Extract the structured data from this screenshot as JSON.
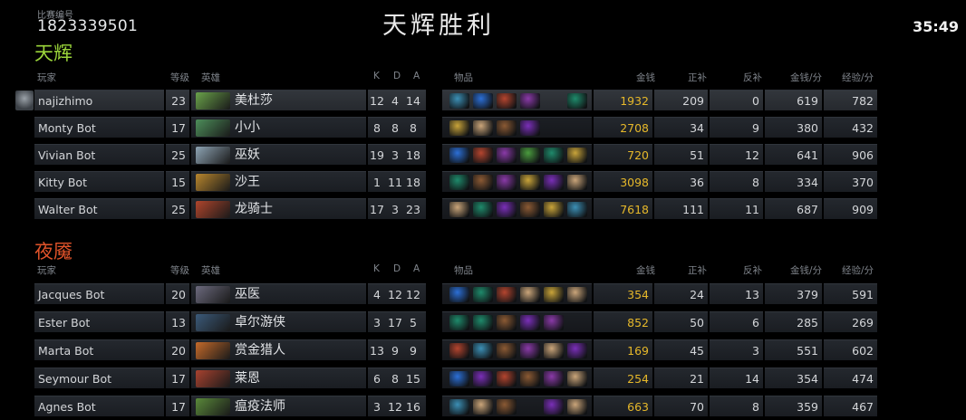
{
  "match": {
    "id_label": "比赛编号",
    "id": "1823339501",
    "result": "天辉胜利",
    "time": "35:49"
  },
  "headers": {
    "player": "玩家",
    "level": "等级",
    "hero": "英雄",
    "k": "K",
    "d": "D",
    "a": "A",
    "items": "物品",
    "gold": "金钱",
    "last_hits": "正补",
    "denies": "反补",
    "gpm": "金钱/分",
    "xpm": "经验/分"
  },
  "radiant": {
    "name": "天辉",
    "color": "#9ad43a",
    "players": [
      {
        "name": "najizhimo",
        "level": "23",
        "hero": "美杜莎",
        "k": "12",
        "d": "4",
        "a": "14",
        "gold": "1932",
        "lh": "209",
        "dn": "0",
        "gpm": "619",
        "xpm": "782",
        "items": [
          0,
          1,
          2,
          3,
          "",
          5
        ]
      },
      {
        "name": "Monty Bot",
        "level": "17",
        "hero": "小小",
        "k": "8",
        "d": "8",
        "a": "8",
        "gold": "2708",
        "lh": "34",
        "dn": "9",
        "gpm": "380",
        "xpm": "432",
        "items": [
          6,
          7,
          8,
          9,
          "",
          10
        ]
      },
      {
        "name": "Vivian Bot",
        "level": "25",
        "hero": "巫妖",
        "k": "19",
        "d": "3",
        "a": "18",
        "gold": "720",
        "lh": "51",
        "dn": "12",
        "gpm": "641",
        "xpm": "906",
        "items": [
          1,
          2,
          3,
          4,
          5,
          6
        ]
      },
      {
        "name": "Kitty Bot",
        "level": "15",
        "hero": "沙王",
        "k": "1",
        "d": "11",
        "a": "18",
        "gold": "3098",
        "lh": "36",
        "dn": "8",
        "gpm": "334",
        "xpm": "370",
        "items": [
          5,
          8,
          3,
          6,
          9,
          7
        ]
      },
      {
        "name": "Walter Bot",
        "level": "25",
        "hero": "龙骑士",
        "k": "17",
        "d": "3",
        "a": "23",
        "gold": "7618",
        "lh": "111",
        "dn": "11",
        "gpm": "687",
        "xpm": "909",
        "items": [
          7,
          5,
          9,
          8,
          6,
          0
        ]
      }
    ]
  },
  "dire": {
    "name": "夜魇",
    "color": "#e0532a",
    "players": [
      {
        "name": "Jacques Bot",
        "level": "20",
        "hero": "巫医",
        "k": "4",
        "d": "12",
        "a": "12",
        "gold": "354",
        "lh": "24",
        "dn": "13",
        "gpm": "379",
        "xpm": "591",
        "items": [
          1,
          5,
          2,
          7,
          6,
          7
        ]
      },
      {
        "name": "Ester Bot",
        "level": "13",
        "hero": "卓尔游侠",
        "k": "3",
        "d": "17",
        "a": "5",
        "gold": "852",
        "lh": "50",
        "dn": "6",
        "gpm": "285",
        "xpm": "269",
        "items": [
          5,
          5,
          8,
          9,
          3,
          ""
        ]
      },
      {
        "name": "Marta Bot",
        "level": "20",
        "hero": "赏金猎人",
        "k": "13",
        "d": "9",
        "a": "9",
        "gold": "169",
        "lh": "45",
        "dn": "3",
        "gpm": "551",
        "xpm": "602",
        "items": [
          2,
          0,
          8,
          3,
          7,
          9
        ]
      },
      {
        "name": "Seymour Bot",
        "level": "17",
        "hero": "莱恩",
        "k": "6",
        "d": "8",
        "a": "15",
        "gold": "254",
        "lh": "21",
        "dn": "14",
        "gpm": "354",
        "xpm": "474",
        "items": [
          1,
          9,
          2,
          8,
          3,
          7
        ]
      },
      {
        "name": "Agnes Bot",
        "level": "17",
        "hero": "瘟疫法师",
        "k": "3",
        "d": "12",
        "a": "16",
        "gold": "663",
        "lh": "70",
        "dn": "8",
        "gpm": "359",
        "xpm": "467",
        "items": [
          0,
          7,
          8,
          "",
          9,
          7
        ]
      }
    ]
  },
  "item_palette": [
    "#3c8fb5",
    "#2c6fd6",
    "#b4452f",
    "#8a3aa8",
    "#4a9b3e",
    "#1f8a6b",
    "#c9a43a",
    "#caa57a",
    "#8b5a34",
    "#7a2fb8"
  ],
  "hero_palette": {
    "radiant": [
      "#6aa34a",
      "#4d8f5a",
      "#8fa5b5",
      "#b8862d",
      "#b0452c"
    ],
    "dire": [
      "#6c6a7e",
      "#3b5a7a",
      "#c56a2a",
      "#a8422f",
      "#5a8a3a"
    ]
  }
}
